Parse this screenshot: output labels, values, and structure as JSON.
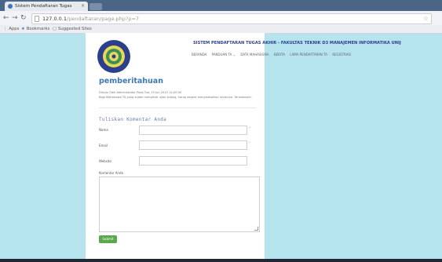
{
  "browser": {
    "tab_title": "Sistem Pendaftaran Tugas",
    "tab_close": "×",
    "url_host": "127.0.0.1",
    "url_path": "/pendaftaran/page.php?p=7",
    "bookmarks": [
      "Apps",
      "Bookmarks",
      "Suggested Sites"
    ]
  },
  "site": {
    "title": "SISTEM PENDAFTARAN TUGAS AKHIR - FAKULTAS TEKNIK D3 MANAJEMEN INFORMATIKA UNIJ",
    "menu": [
      "BERANDA",
      "PANDUAN TA ⌄",
      "DATA MAHASISWA",
      "BERITA",
      "LAMA PENDAFTARAN TA",
      "REGISTRASI"
    ]
  },
  "post": {
    "title": "pemberitahuan",
    "meta": "Diisuls Oleh Administrator Pada Tue, 15 Jun 2015 12:00:00",
    "body": "Bagi Mahasiswa TA yang sudah mengikuti ujian sidang, harap segera menyelesaikan revisinya. Terimakasih."
  },
  "form": {
    "heading": "Tuliskan Komentar Anda",
    "name_label": "Nama",
    "email_label": "Email",
    "website_label": "Website",
    "comment_label": "Komentar Anda",
    "required_mark": "*",
    "submit_label": "Submit"
  },
  "colors": {
    "page_bg": "#b5e3ee",
    "title_blue": "#2f3f8f",
    "heading_blue": "#3e78b5",
    "submit_green": "#5aa84a"
  }
}
